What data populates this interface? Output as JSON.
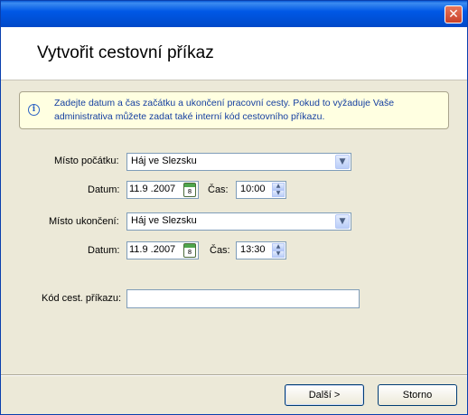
{
  "window": {
    "close_glyph": "✕"
  },
  "header": {
    "title": "Vytvořit cestovní příkaz"
  },
  "info": {
    "icon": "info-icon",
    "text": "Zadejte datum a čas začátku a ukončení pracovní cesty. Pokud to vyžaduje Vaše administrativa můžete zadat také interní kód cestovního příkazu."
  },
  "start": {
    "place_label": "Místo počátku:",
    "place_value": "Háj ve Slezsku",
    "date_label": "Datum:",
    "date_value": "11.9 .2007",
    "calendar_day": "8",
    "time_label": "Čas:",
    "time_value": "10:00"
  },
  "end": {
    "place_label": "Místo ukončení:",
    "place_value": "Háj ve Slezsku",
    "date_label": "Datum:",
    "date_value": "11.9 .2007",
    "calendar_day": "8",
    "time_label": "Čas:",
    "time_value": "13:30"
  },
  "code": {
    "label": "Kód cest. příkazu:",
    "value": ""
  },
  "buttons": {
    "next": "Další >",
    "cancel": "Storno"
  }
}
